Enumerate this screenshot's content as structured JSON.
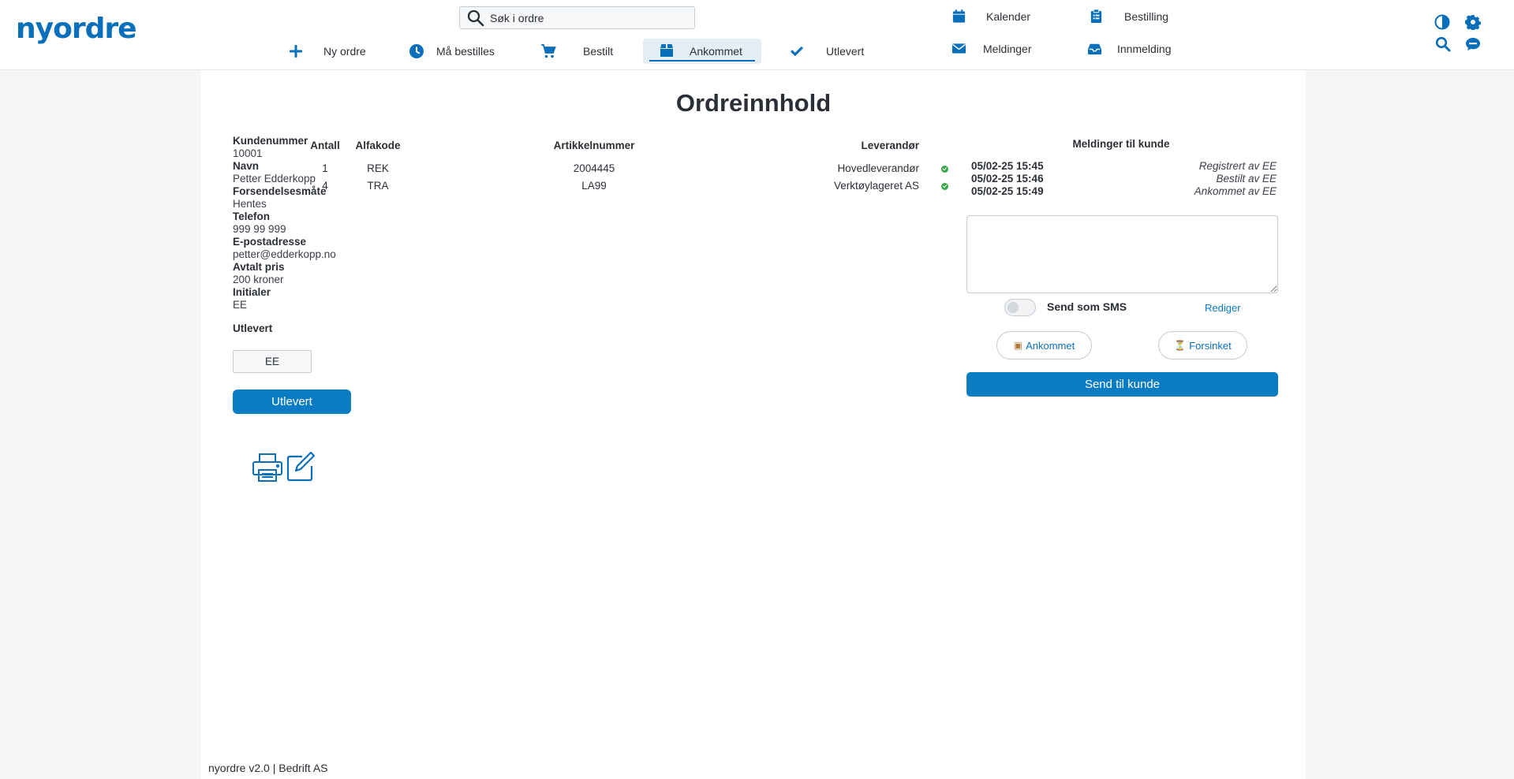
{
  "brand": {
    "logo_text": "nyordre"
  },
  "search": {
    "placeholder": "Søk i ordre"
  },
  "nav": {
    "items": [
      {
        "label": "Ny ordre",
        "icon": "plus-icon"
      },
      {
        "label": "Må bestilles",
        "icon": "clock-icon"
      },
      {
        "label": "Bestilt",
        "icon": "cart-icon"
      },
      {
        "label": "Ankommet",
        "icon": "box-icon",
        "active": true
      },
      {
        "label": "Utlevert",
        "icon": "check-icon"
      }
    ]
  },
  "topnav": {
    "kalender": "Kalender",
    "bestilling": "Bestilling",
    "meldinger": "Meldinger",
    "innmelding": "Innmelding"
  },
  "page": {
    "title": "Ordreinnhold"
  },
  "customer": {
    "kundenummer_label": "Kundenummer",
    "kundenummer": "10001",
    "navn_label": "Navn",
    "navn": "Petter Edderkopp",
    "forsendelse_label": "Forsendelsesmåte",
    "forsendelse": "Hentes",
    "telefon_label": "Telefon",
    "telefon": "999 99 999",
    "epost_label": "E-postadresse",
    "epost": "petter@edderkopp.no",
    "pris_label": "Avtalt pris",
    "pris": "200 kroner",
    "initialer_label": "Initialer",
    "initialer": "EE"
  },
  "delivery": {
    "label": "Utlevert",
    "initials_value": "EE",
    "button_label": "Utlevert"
  },
  "table": {
    "headers": {
      "antall": "Antall",
      "alfakode": "Alfakode",
      "artikkel": "Artikkelnummer",
      "leverandor": "Leverandør"
    },
    "rows": [
      {
        "antall": "1",
        "alfakode": "REK",
        "artikkel": "2004445",
        "leverandor": "Hovedleverandør",
        "status_color": "#3aa64a"
      },
      {
        "antall": "4",
        "alfakode": "TRA",
        "artikkel": "LA99",
        "leverandor": "Verktøylageret AS",
        "status_color": "#3aa64a"
      }
    ]
  },
  "messages": {
    "title": "Meldinger til kunde",
    "log": [
      {
        "timestamp": "05/02-25 15:45",
        "event": "Registrert av EE"
      },
      {
        "timestamp": "05/02-25 15:46",
        "event": "Bestilt av EE"
      },
      {
        "timestamp": "05/02-25 15:49",
        "event": "Ankommet av EE"
      }
    ],
    "textarea_value": "",
    "sms_label": "Send som SMS",
    "sms_enabled": false,
    "edit_link": "Rediger",
    "template_ankommet": "Ankommet",
    "template_forsinket": "Forsinket",
    "send_button": "Send til kunde"
  },
  "colors": {
    "accent": "#0a7cc4",
    "status_ok": "#3aa64a"
  },
  "footer": {
    "text": "nyordre v2.0 | Bedrift AS"
  }
}
